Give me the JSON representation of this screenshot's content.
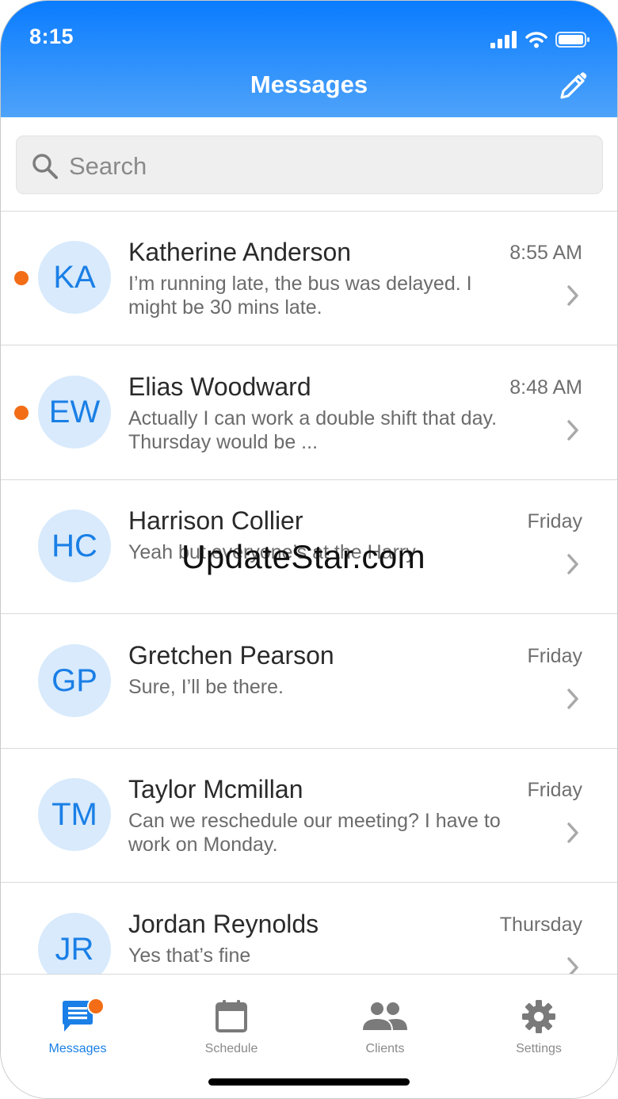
{
  "status_bar": {
    "time": "8:15"
  },
  "header": {
    "title": "Messages"
  },
  "search": {
    "placeholder": "Search"
  },
  "conversations": [
    {
      "initials": "KA",
      "name": "Katherine Anderson",
      "time": "8:55 AM",
      "preview": "I’m running late, the bus was delayed. I might be 30 mins late.",
      "unread": true
    },
    {
      "initials": "EW",
      "name": "Elias Woodward",
      "time": "8:48 AM",
      "preview": "Actually I can work a double shift that day. Thursday would be ...",
      "unread": true
    },
    {
      "initials": "HC",
      "name": "Harrison Collier",
      "time": "Friday",
      "preview": "Yeah but everyone’s at the Harry",
      "unread": false
    },
    {
      "initials": "GP",
      "name": "Gretchen Pearson",
      "time": "Friday",
      "preview": "Sure, I’ll be there.",
      "unread": false
    },
    {
      "initials": "TM",
      "name": "Taylor Mcmillan",
      "time": "Friday",
      "preview": "Can we reschedule our meeting? I have to work on Monday.",
      "unread": false
    },
    {
      "initials": "JR",
      "name": "Jordan Reynolds",
      "time": "Thursday",
      "preview": "Yes that’s fine",
      "unread": false
    }
  ],
  "watermark": "UpdateStar.com",
  "tabs": [
    {
      "label": "Messages",
      "icon": "chat-icon",
      "active": true,
      "badge": true
    },
    {
      "label": "Schedule",
      "icon": "calendar-icon",
      "active": false
    },
    {
      "label": "Clients",
      "icon": "people-icon",
      "active": false
    },
    {
      "label": "Settings",
      "icon": "gear-icon",
      "active": false
    }
  ],
  "colors": {
    "accent": "#1a7fe6",
    "header_top": "#0a7cff",
    "header_bottom": "#4ea3f9",
    "unread": "#f26d16",
    "avatar_bg": "#d8eafc"
  }
}
